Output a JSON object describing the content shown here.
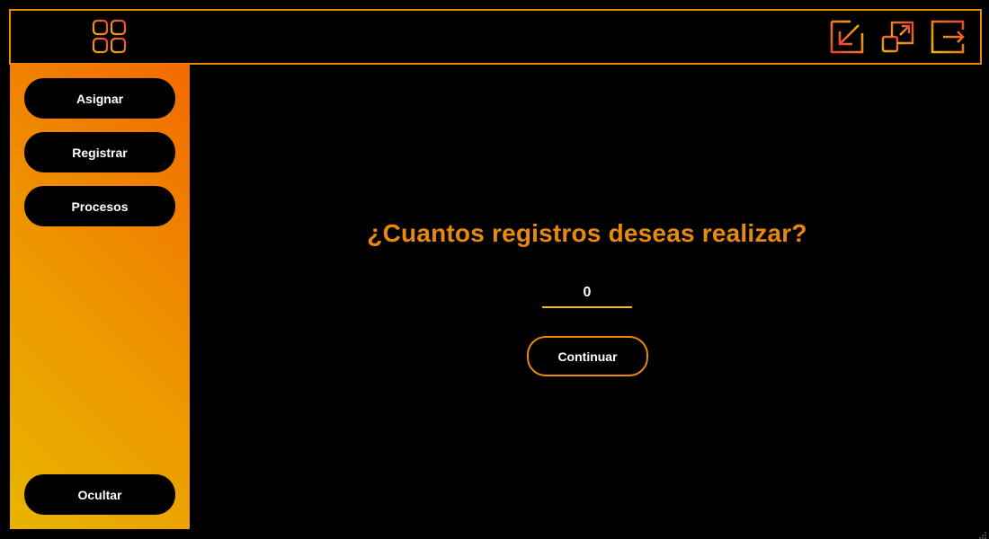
{
  "topbar": {
    "icons": [
      "apps-grid-icon",
      "minimize-icon",
      "restore-window-icon",
      "logout-icon"
    ]
  },
  "sidebar": {
    "items": [
      {
        "label": "Asignar"
      },
      {
        "label": "Registrar"
      },
      {
        "label": "Procesos"
      }
    ],
    "hide_label": "Ocultar"
  },
  "main": {
    "question": "¿Cuantos registros deseas realizar?",
    "count_value": "0",
    "continue_label": "Continuar"
  },
  "colors": {
    "background": "#000000",
    "accent_orange": "#e8890c",
    "gradient_yellow": "#e8b400",
    "gradient_orange": "#f26a00",
    "icon_red": "#e8453c",
    "input_underline": "#f2c200",
    "text_white": "#ffffff"
  }
}
